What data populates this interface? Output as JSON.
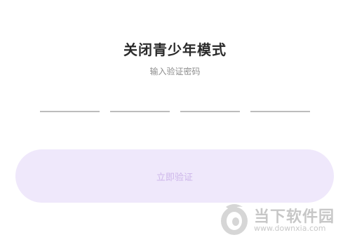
{
  "page": {
    "title": "关闭青少年模式",
    "subtitle": "输入验证密码"
  },
  "code_inputs": [
    {
      "value": ""
    },
    {
      "value": ""
    },
    {
      "value": ""
    },
    {
      "value": ""
    }
  ],
  "submit": {
    "label": "立即验证"
  },
  "watermark": {
    "name": "当下软件园",
    "url": "www.downxia.com"
  },
  "colors": {
    "button_bg": "#efe8fb",
    "button_text": "#cdb6ea",
    "underline": "#bcbcbc"
  }
}
